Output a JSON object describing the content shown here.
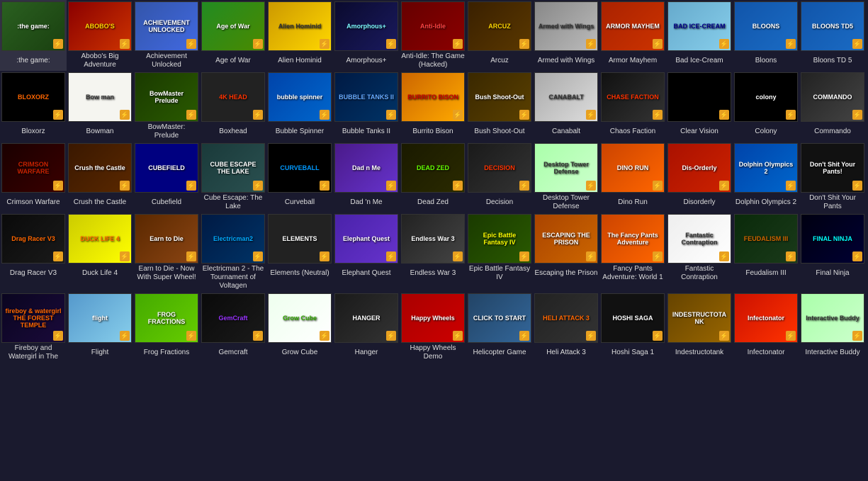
{
  "games": [
    {
      "id": "the-game",
      "label": ":the game:",
      "bg": "#2a6020",
      "text": ":the game:",
      "color": "#fff"
    },
    {
      "id": "abobos-big-adventure",
      "label": "Abobo's Big Adventure",
      "bg": "#8B0000",
      "text": "ABOBO'S",
      "color": "#FFD700"
    },
    {
      "id": "achievement-unlocked",
      "label": "Achievement Unlocked",
      "bg": "#4169E1",
      "text": "ACHIEVEMENT UNLOCKED",
      "color": "#fff"
    },
    {
      "id": "age-of-war",
      "label": "Age of War",
      "bg": "#228B22",
      "text": "Age of War",
      "color": "#fff"
    },
    {
      "id": "alien-hominid",
      "label": "Alien Hominid",
      "bg": "#FFD700",
      "text": "Alien Hominid",
      "color": "#333"
    },
    {
      "id": "amorphous",
      "label": "Amorphous+",
      "bg": "#1a1a3e",
      "text": "Amorphous+",
      "color": "#7DF9FF"
    },
    {
      "id": "anti-idle",
      "label": "Anti-Idle: The Game (Hacked)",
      "bg": "#8B0000",
      "text": "Anti-Idle",
      "color": "#ff4444"
    },
    {
      "id": "arcuz",
      "label": "Arcuz",
      "bg": "#4a3000",
      "text": "ARCUZ",
      "color": "#FFD700"
    },
    {
      "id": "armed-with-wings",
      "label": "Armed with Wings",
      "bg": "#aaa",
      "text": "Armed with Wings",
      "color": "#333"
    },
    {
      "id": "armor-mayhem",
      "label": "Armor Mayhem",
      "bg": "#cc3300",
      "text": "ARMOR MAYHEM",
      "color": "#fff"
    },
    {
      "id": "bad-ice-cream",
      "label": "Bad Ice-Cream",
      "bg": "#87CEEB",
      "text": "BAD ICE-CREAM",
      "color": "#00008B"
    },
    {
      "id": "bloons",
      "label": "Bloons",
      "bg": "#1a6bc4",
      "text": "BLOONS",
      "color": "#fff"
    },
    {
      "id": "bloons-td5",
      "label": "Bloons TD 5",
      "bg": "#1a6bc4",
      "text": "BLOONS TD5",
      "color": "#fff"
    },
    {
      "id": "bloxorz",
      "label": "Bloxorz",
      "bg": "#000",
      "text": "BLOXORZ",
      "color": "#ff6600"
    },
    {
      "id": "bowman",
      "label": "Bowman",
      "bg": "#fff",
      "text": "Bow man",
      "color": "#333"
    },
    {
      "id": "bowmaster-prelude",
      "label": "BowMaster: Prelude",
      "bg": "#2a4a00",
      "text": "BowMaster Prelude",
      "color": "#fff"
    },
    {
      "id": "boxhead",
      "label": "Boxhead",
      "bg": "#333",
      "text": "4K HEAD",
      "color": "#ff3300"
    },
    {
      "id": "bubble-spinner",
      "label": "Bubble Spinner",
      "bg": "#0066cc",
      "text": "bubble spinner",
      "color": "#fff"
    },
    {
      "id": "bubble-tanks-ii",
      "label": "Bubble Tanks II",
      "bg": "#003366",
      "text": "BUBBLE TANKS II",
      "color": "#66aaff"
    },
    {
      "id": "burrito-bison",
      "label": "Burrito Bison",
      "bg": "#ffaa00",
      "text": "BURRITO BISON",
      "color": "#cc0000"
    },
    {
      "id": "bush-shoot-out",
      "label": "Bush Shoot-Out",
      "bg": "#4a3000",
      "text": "Bush Shoot-Out",
      "color": "#fff"
    },
    {
      "id": "canabalt",
      "label": "Canabalt",
      "bg": "#ccc",
      "text": "CANABALT",
      "color": "#333"
    },
    {
      "id": "chaos-faction",
      "label": "Chaos Faction",
      "bg": "#222",
      "text": "CHASE FACTION",
      "color": "#ff3300"
    },
    {
      "id": "clear-vision",
      "label": "Clear Vision",
      "bg": "#000",
      "text": "",
      "color": "#fff"
    },
    {
      "id": "colony",
      "label": "Colony",
      "bg": "#000",
      "text": "colony",
      "color": "#fff"
    },
    {
      "id": "commando",
      "label": "Commando",
      "bg": "#333",
      "text": "COMMANDO",
      "color": "#fff"
    },
    {
      "id": "crimson-warfare",
      "label": "Crimson Warfare",
      "bg": "#3a0000",
      "text": "CRIMSON WARFARE",
      "color": "#cc2200"
    },
    {
      "id": "crush-the-castle",
      "label": "Crush the Castle",
      "bg": "#4a2800",
      "text": "Crush the Castle",
      "color": "#fff"
    },
    {
      "id": "cubefield",
      "label": "Cubefield",
      "bg": "#000080",
      "text": "CUBEFIELD",
      "color": "#fff"
    },
    {
      "id": "cube-escape-lake",
      "label": "Cube Escape: The Lake",
      "bg": "#2a5050",
      "text": "CUBE ESCAPE THE LAKE",
      "color": "#fff"
    },
    {
      "id": "curveball",
      "label": "Curveball",
      "bg": "#000",
      "text": "CURVEBALL",
      "color": "#0099ff"
    },
    {
      "id": "dad-n-me",
      "label": "Dad 'n Me",
      "bg": "#6633cc",
      "text": "Dad n Me",
      "color": "#fff"
    },
    {
      "id": "dead-zed",
      "label": "Dead Zed",
      "bg": "#2a2a00",
      "text": "DEAD ZED",
      "color": "#66ff00"
    },
    {
      "id": "decision",
      "label": "Decision",
      "bg": "#333",
      "text": "DECISION",
      "color": "#ff3300"
    },
    {
      "id": "desktop-tower-defense",
      "label": "Desktop Tower Defense",
      "bg": "#ccffcc",
      "text": "Desktop Tower Defense",
      "color": "#333"
    },
    {
      "id": "dino-run",
      "label": "Dino Run",
      "bg": "#ff6600",
      "text": "DINO RUN",
      "color": "#fff"
    },
    {
      "id": "disorderly",
      "label": "Disorderly",
      "bg": "#cc2200",
      "text": "Dis-Orderly",
      "color": "#fff"
    },
    {
      "id": "dolphin-olympics-2",
      "label": "Dolphin Olympics 2",
      "bg": "#0066cc",
      "text": "Dolphin Olympics 2",
      "color": "#fff"
    },
    {
      "id": "dont-shit-your-pants",
      "label": "Don't Shit Your Pants",
      "bg": "#222",
      "text": "Don't Shit Your Pants!",
      "color": "#fff"
    },
    {
      "id": "drag-racer-v3",
      "label": "Drag Racer V3",
      "bg": "#1a1a1a",
      "text": "Drag Racer V3",
      "color": "#ff6600"
    },
    {
      "id": "duck-life-4",
      "label": "Duck Life 4",
      "bg": "#ffff00",
      "text": "DUCK LIFE 4",
      "color": "#ff6600"
    },
    {
      "id": "earn-to-die",
      "label": "Earn to Die - Now With Super Wheel!",
      "bg": "#8B4513",
      "text": "Earn to Die",
      "color": "#fff"
    },
    {
      "id": "electricman-2",
      "label": "Electricman 2 - The Tournament of Voltagen",
      "bg": "#003366",
      "text": "Electricman2",
      "color": "#00aaff"
    },
    {
      "id": "elements-neutral",
      "label": "Elements (Neutral)",
      "bg": "#333",
      "text": "ELEMENTS",
      "color": "#fff"
    },
    {
      "id": "elephant-quest",
      "label": "Elephant Quest",
      "bg": "#6633cc",
      "text": "Elephant Quest",
      "color": "#fff"
    },
    {
      "id": "endless-war-3",
      "label": "Endless War 3",
      "bg": "#444",
      "text": "Endless War 3",
      "color": "#fff"
    },
    {
      "id": "epic-battle-fantasy-iv",
      "label": "Epic Battle Fantasy IV",
      "bg": "#2a4a00",
      "text": "Epic Battle Fantasy IV",
      "color": "#ffff00"
    },
    {
      "id": "escaping-the-prison",
      "label": "Escaping the Prison",
      "bg": "#cc6600",
      "text": "ESCAPING THE PRISON",
      "color": "#fff"
    },
    {
      "id": "fancy-pants-adventure",
      "label": "Fancy Pants Adventure: World 1",
      "bg": "#ff6600",
      "text": "The Fancy Pants Adventure",
      "color": "#fff"
    },
    {
      "id": "fantastic-contraption",
      "label": "Fantastic Contraption",
      "bg": "#fff",
      "text": "Fantastic Contraption",
      "color": "#333"
    },
    {
      "id": "feudalism-iii",
      "label": "Feudalism III",
      "bg": "#1a3a1a",
      "text": "FEUDALISM III",
      "color": "#cc6600"
    },
    {
      "id": "final-ninja",
      "label": "Final Ninja",
      "bg": "#000033",
      "text": "FINAL NINJA",
      "color": "#00ffff"
    },
    {
      "id": "fireboy-watergirl",
      "label": "Fireboy and Watergirl in The",
      "bg": "#1a0a3a",
      "text": "fireboy & watergirl THE FOREST TEMPLE",
      "color": "#ff6600"
    },
    {
      "id": "flight",
      "label": "Flight",
      "bg": "#87CEEB",
      "text": "flight",
      "color": "#fff"
    },
    {
      "id": "frog-fractions",
      "label": "Frog Fractions",
      "bg": "#66cc00",
      "text": "FROG FRACTIONS",
      "color": "#fff"
    },
    {
      "id": "gemcraft",
      "label": "Gemcraft",
      "bg": "#1a1a1a",
      "text": "GemCraft",
      "color": "#9933ff"
    },
    {
      "id": "grow-cube",
      "label": "Grow Cube",
      "bg": "#ffffff",
      "text": "Grow Cube",
      "color": "#33aa00"
    },
    {
      "id": "hanger",
      "label": "Hanger",
      "bg": "#333",
      "text": "HANGER",
      "color": "#fff"
    },
    {
      "id": "happy-wheels-demo",
      "label": "Happy Wheels Demo",
      "bg": "#cc0000",
      "text": "Happy Wheels",
      "color": "#fff"
    },
    {
      "id": "helicopter-game",
      "label": "Helicopter Game",
      "bg": "#336699",
      "text": "CLICK TO START",
      "color": "#fff"
    },
    {
      "id": "heli-attack-3",
      "label": "Heli Attack 3",
      "bg": "#333",
      "text": "HELI ATTACK 3",
      "color": "#ff6600"
    },
    {
      "id": "hoshi-saga",
      "label": "Hoshi Saga 1",
      "bg": "#222",
      "text": "HOSHI SAGA",
      "color": "#fff"
    },
    {
      "id": "indestructotank",
      "label": "Indestructotank",
      "bg": "#996600",
      "text": "INDESTRUCTOTANK",
      "color": "#fff"
    },
    {
      "id": "infectonator",
      "label": "Infectonator",
      "bg": "#ff3300",
      "text": "Infectonator",
      "color": "#fff"
    },
    {
      "id": "interactive-buddy",
      "label": "Interactive Buddy",
      "bg": "#ccffcc",
      "text": "Interactive Buddy",
      "color": "#333"
    }
  ],
  "flash_icon": "⚡"
}
